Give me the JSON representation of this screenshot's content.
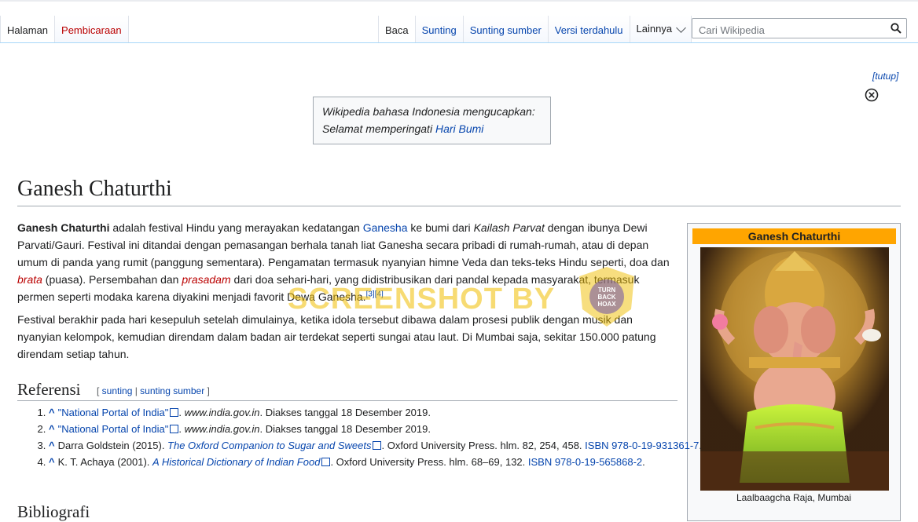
{
  "nav": {
    "left_tabs": [
      "Halaman",
      "Pembicaraan"
    ],
    "right_tabs": [
      "Baca",
      "Sunting",
      "Sunting sumber",
      "Versi terdahulu"
    ],
    "more_label": "Lainnya",
    "search_placeholder": "Cari Wikipedia"
  },
  "banner": {
    "close_link": "[tutup]",
    "line1": "Wikipedia bahasa Indonesia mengucapkan:",
    "line2_prefix": "Selamat memperingati ",
    "line2_link": "Hari Bumi"
  },
  "article": {
    "title": "Ganesh Chaturthi",
    "p1": {
      "bold": "Ganesh Chaturthi",
      "t1": " adalah festival Hindu yang merayakan kedatangan ",
      "link1": "Ganesha",
      "t2": " ke bumi dari ",
      "italic1": "Kailash Parvat",
      "t3": " dengan ibunya Dewi Parvati/Gauri. Festival ini ditandai dengan pemasangan berhala tanah liat Ganesha secara pribadi di rumah-rumah, atau di depan umum di panda yang rumit (panggung sementara). Pengamatan termasuk nyanyian himne Veda dan teks-teks Hindu seperti, doa dan ",
      "redlink1": "brata",
      "t4": " (puasa). Persembahan dan ",
      "redlink2": "prasadam",
      "t5": " dari doa sehari-hari, yang didistribusikan dari pandal kepada masyarakat, termasuk permen seperti modaka karena diyakini menjadi favorit Dewa Ganesha.",
      "cite": "[3][4]"
    },
    "p2": "Festival berakhir pada hari kesepuluh setelah dimulainya, ketika idola tersebut dibawa dalam prosesi publik dengan musik dan nyanyian kelompok, kemudian direndam dalam badan air terdekat seperti sungai atau laut. Di Mumbai saja, sekitar 150.000 patung direndam setiap tahun."
  },
  "infobox": {
    "title": "Ganesh Chaturthi",
    "caption": "Laalbaagcha Raja, Mumbai"
  },
  "references": {
    "heading": "Referensi",
    "edit_open": "[ ",
    "edit_link1": "sunting",
    "edit_sep": " | ",
    "edit_link2": "sunting sumber",
    "edit_close": " ]",
    "items": [
      {
        "link": "\"National Portal of India\"",
        "rest_italic": "www.india.gov.in",
        "rest": ". Diakses tanggal 18 Desember 2019."
      },
      {
        "link": "\"National Portal of India\"",
        "rest_italic": "www.india.gov.in",
        "rest": ". Diakses tanggal 18 Desember 2019."
      },
      {
        "pre": "Darra Goldstein (2015). ",
        "link": "The Oxford Companion to Sugar and Sweets",
        "rest": ". Oxford University Press. hlm. 82, 254, 458. ",
        "isbn": "ISBN 978-0-19-931361-7",
        "end": "."
      },
      {
        "pre": "K. T. Achaya (2001). ",
        "link": "A Historical Dictionary of Indian Food",
        "rest": ". Oxford University Press. hlm. 68–69, 132. ",
        "isbn": "ISBN 978-0-19-565868-2",
        "end": "."
      }
    ]
  },
  "next_heading": "Bibliografi",
  "watermark": {
    "text": "SCREENSHOT BY",
    "logo_lines": [
      "TURN",
      "BACK",
      "HOAX"
    ]
  },
  "colors": {
    "link": "#0645ad",
    "redlink": "#ba0000",
    "infobox_header": "#ffa500",
    "watermark": "#f0be00"
  }
}
